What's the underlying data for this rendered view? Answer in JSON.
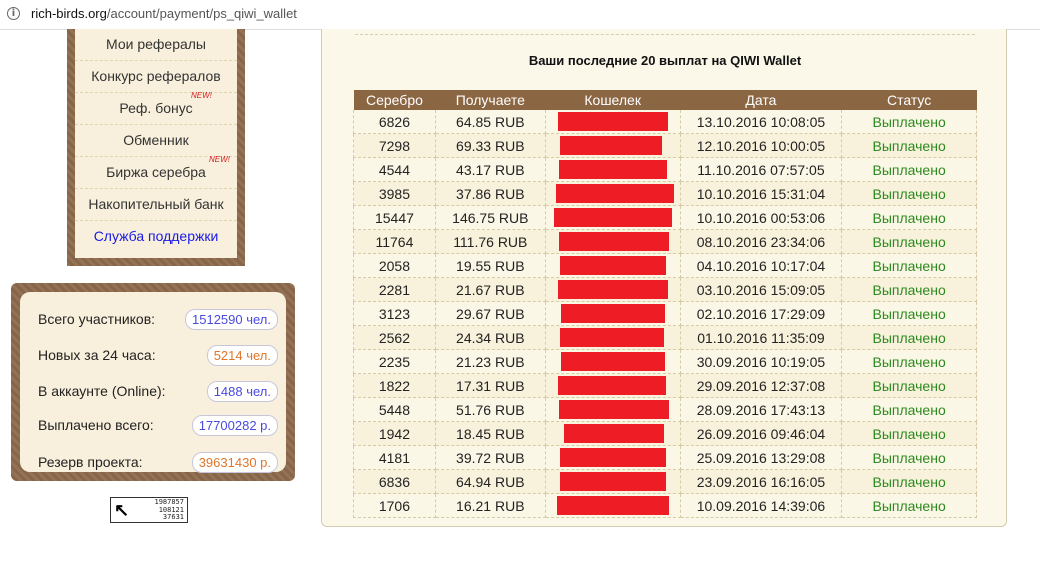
{
  "browser": {
    "url_host": "rich-birds.org",
    "url_path": "/account/payment/ps_qiwi_wallet"
  },
  "menu": {
    "items": [
      {
        "label": "Мои рефералы"
      },
      {
        "label": "Конкурс рефералов"
      },
      {
        "label": "Реф. бонус",
        "badge": "NEW!"
      },
      {
        "label": "Обменник"
      },
      {
        "label": "Биржа серебра",
        "badge": "NEW!"
      },
      {
        "label": "Накопительный банк"
      },
      {
        "label": "Служба поддержки"
      }
    ]
  },
  "stats": {
    "total_label": "Всего участников:",
    "total_value": "1512590 чел.",
    "new_label": "Новых за 24 часа:",
    "new_value": "5214 чел.",
    "online_label": "В аккаунте (Online):",
    "online_value": "1488 чел.",
    "paid_label": "Выплачено всего:",
    "paid_value": "17700282 р.",
    "reserve_label": "Резерв проекта:",
    "reserve_value": "39631430 р."
  },
  "counter": {
    "line1": "1987857",
    "line2": "108121",
    "line3": "37631"
  },
  "payments": {
    "title": "Ваши последние 20 выплат на QIWI Wallet",
    "columns": [
      "Серебро",
      "Получаете",
      "Кошелек",
      "Дата",
      "Статус"
    ],
    "rows": [
      {
        "silver": "6826",
        "amount": "64.85 RUB",
        "date": "13.10.2016 10:08:05",
        "status": "Выплачено"
      },
      {
        "silver": "7298",
        "amount": "69.33 RUB",
        "date": "12.10.2016 10:00:05",
        "status": "Выплачено"
      },
      {
        "silver": "4544",
        "amount": "43.17 RUB",
        "date": "11.10.2016 07:57:05",
        "status": "Выплачено"
      },
      {
        "silver": "3985",
        "amount": "37.86 RUB",
        "date": "10.10.2016 15:31:04",
        "status": "Выплачено"
      },
      {
        "silver": "15447",
        "amount": "146.75 RUB",
        "date": "10.10.2016 00:53:06",
        "status": "Выплачено"
      },
      {
        "silver": "11764",
        "amount": "111.76 RUB",
        "date": "08.10.2016 23:34:06",
        "status": "Выплачено"
      },
      {
        "silver": "2058",
        "amount": "19.55 RUB",
        "date": "04.10.2016 10:17:04",
        "status": "Выплачено"
      },
      {
        "silver": "2281",
        "amount": "21.67 RUB",
        "date": "03.10.2016 15:09:05",
        "status": "Выплачено"
      },
      {
        "silver": "3123",
        "amount": "29.67 RUB",
        "date": "02.10.2016 17:29:09",
        "status": "Выплачено"
      },
      {
        "silver": "2562",
        "amount": "24.34 RUB",
        "date": "01.10.2016 11:35:09",
        "status": "Выплачено"
      },
      {
        "silver": "2235",
        "amount": "21.23 RUB",
        "date": "30.09.2016 10:19:05",
        "status": "Выплачено"
      },
      {
        "silver": "1822",
        "amount": "17.31 RUB",
        "date": "29.09.2016 12:37:08",
        "status": "Выплачено"
      },
      {
        "silver": "5448",
        "amount": "51.76 RUB",
        "date": "28.09.2016 17:43:13",
        "status": "Выплачено"
      },
      {
        "silver": "1942",
        "amount": "18.45 RUB",
        "date": "26.09.2016 09:46:04",
        "status": "Выплачено"
      },
      {
        "silver": "4181",
        "amount": "39.72 RUB",
        "date": "25.09.2016 13:29:08",
        "status": "Выплачено"
      },
      {
        "silver": "6836",
        "amount": "64.94 RUB",
        "date": "23.09.2016 16:16:05",
        "status": "Выплачено"
      },
      {
        "silver": "1706",
        "amount": "16.21 RUB",
        "date": "10.09.2016 14:39:06",
        "status": "Выплачено"
      }
    ]
  },
  "colors": {
    "frame_brown": "#8d6a4c",
    "header_brown": "#8b6643",
    "paid_green": "#2c8a1e",
    "redaction_red": "#ee1c25",
    "link_blue": "#1a1ae6"
  }
}
